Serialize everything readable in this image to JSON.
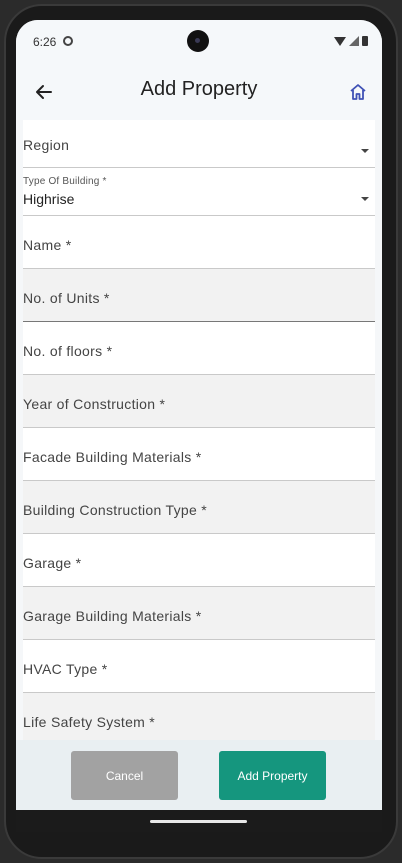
{
  "status_bar": {
    "time": "6:26",
    "settings_icon": "gear-icon",
    "wifi_icon": "wifi-icon",
    "signal_icon": "signal-icon",
    "battery_icon": "battery-icon"
  },
  "app_bar": {
    "title": "Add Property",
    "back_icon": "arrow-left-icon",
    "home_icon": "home-icon",
    "home_icon_color": "#3f51b5"
  },
  "form": {
    "region": {
      "label": "Region"
    },
    "building_type": {
      "label": "Type Of Building *",
      "value": "Highrise"
    },
    "fields": [
      {
        "label": "Name *"
      },
      {
        "label": "No. of Units *"
      },
      {
        "label": "No. of floors *"
      },
      {
        "label": "Year of Construction *"
      },
      {
        "label": "Facade Building Materials *"
      },
      {
        "label": "Building Construction Type *"
      },
      {
        "label": "Garage *"
      },
      {
        "label": "Garage Building Materials *"
      },
      {
        "label": "HVAC Type *"
      },
      {
        "label": "Life Safety System *"
      }
    ]
  },
  "actions": {
    "cancel_label": "Cancel",
    "add_label": "Add Property",
    "cancel_color": "#a2a2a2",
    "add_color": "#15967e"
  }
}
